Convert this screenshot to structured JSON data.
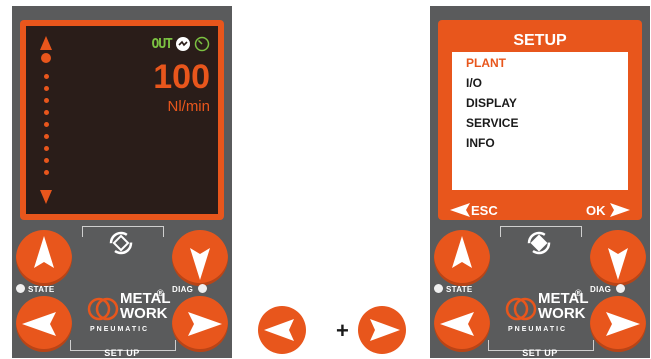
{
  "colors": {
    "accent": "#e8561c",
    "panel": "#5a5b5c",
    "screen_bg": "#2a1d19",
    "out_green": "#7cc242"
  },
  "left_device": {
    "status": {
      "out_label": "OUT",
      "icons": [
        "switch-icon",
        "gauge-icon"
      ]
    },
    "reading": {
      "value": "100",
      "unit": "Nl/min"
    },
    "buttons": {
      "state_label": "STATE",
      "diag_label": "DIAG",
      "setup_label": "SET UP"
    },
    "logo": {
      "line1": "METAL",
      "line2": "WORK",
      "line3": "PNEUMATIC",
      "reg": "®"
    }
  },
  "right_device": {
    "menu": {
      "title": "SETUP",
      "items": [
        "PLANT",
        "I/O",
        "DISPLAY",
        "SERVICE",
        "INFO"
      ],
      "active_index": 0,
      "esc_label": "ESC",
      "ok_label": "OK"
    },
    "buttons": {
      "state_label": "STATE",
      "diag_label": "DIAG",
      "setup_label": "SET UP"
    },
    "logo": {
      "line1": "METAL",
      "line2": "WORK",
      "line3": "PNEUMATIC",
      "reg": "®"
    }
  },
  "combo": {
    "plus": "+"
  }
}
